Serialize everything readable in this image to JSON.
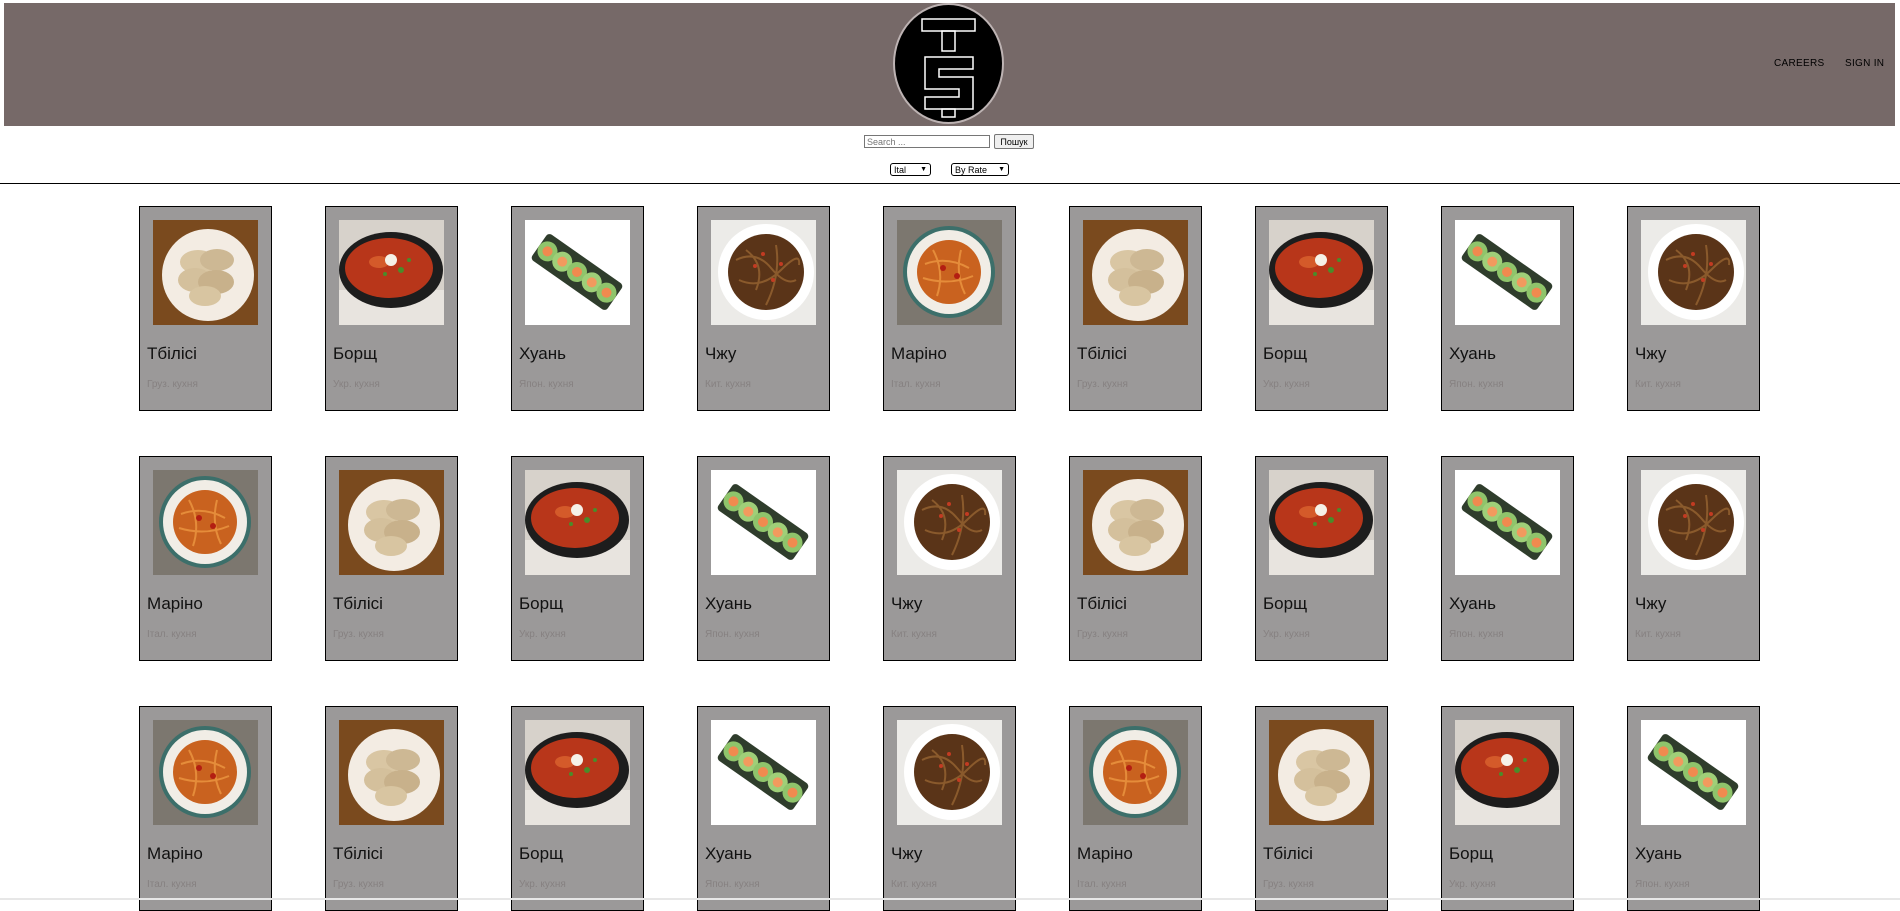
{
  "header": {
    "logo_text": "TS",
    "nav": {
      "careers": "CAREERS",
      "sign_in": "SIGN IN"
    }
  },
  "search": {
    "placeholder": "Search ...",
    "value": "",
    "button_label": "Пошук"
  },
  "filters": {
    "cuisine_selected": "Ital",
    "sort_selected": "By Rate"
  },
  "dishes": {
    "tbilisi": {
      "name": "Тбілісі",
      "cuisine": "Груз. кухня"
    },
    "borshch": {
      "name": "Борщ",
      "cuisine": "Укр. кухня"
    },
    "huan": {
      "name": "Хуань",
      "cuisine": "Япон. кухня"
    },
    "chzhu": {
      "name": "Чжу",
      "cuisine": "Кит. кухня"
    },
    "marino": {
      "name": "Маріно",
      "cuisine": "Італ. кухня"
    }
  },
  "grid": [
    [
      "tbilisi",
      "borshch",
      "huan",
      "chzhu",
      "marino",
      "tbilisi",
      "borshch",
      "huan",
      "chzhu"
    ],
    [
      "marino",
      "tbilisi",
      "borshch",
      "huan",
      "chzhu",
      "tbilisi",
      "borshch",
      "huan",
      "chzhu"
    ],
    [
      "marino",
      "tbilisi",
      "borshch",
      "huan",
      "chzhu",
      "marino",
      "tbilisi",
      "borshch",
      "huan"
    ]
  ]
}
